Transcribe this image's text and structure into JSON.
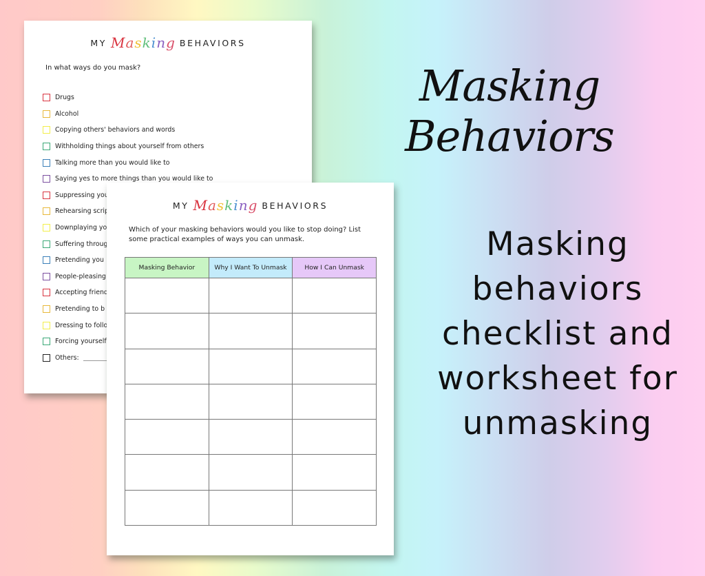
{
  "headline": "Masking Behaviors",
  "subtitle_lines": [
    "Masking",
    "behaviors",
    "checklist and",
    "worksheet for",
    "unmasking"
  ],
  "colors": {
    "red": "#d9333f",
    "orange": "#e8b83a",
    "yellow": "#f2ee4a",
    "green": "#3aa876",
    "blue": "#3a7fb8",
    "purple": "#7b4fa0",
    "black": "#222222",
    "header_green": "#c8f5c4",
    "header_blue": "#c3ebfb",
    "header_purple": "#e6c8f8"
  },
  "doc_title": {
    "prefix": "MY",
    "script_word": [
      "M",
      "a",
      "s",
      "k",
      "i",
      "n",
      "g"
    ],
    "script_colors": [
      "#d9333f",
      "#e05a5a",
      "#f0c23a",
      "#5fbf7a",
      "#4a8fd0",
      "#8a5fc0",
      "#d94f6a"
    ],
    "suffix": "BEHAVIORS"
  },
  "checklist_page": {
    "prompt": "In what ways do you mask?",
    "items": [
      {
        "label": "Drugs",
        "color": "#d9333f"
      },
      {
        "label": "Alcohol",
        "color": "#e8b83a"
      },
      {
        "label": "Copying others' behaviors and words",
        "color": "#f2ee4a"
      },
      {
        "label": "Withholding things about yourself from others",
        "color": "#3aa876"
      },
      {
        "label": "Talking more than you would like to",
        "color": "#3a7fb8"
      },
      {
        "label": "Saying yes to more things than you would like to",
        "color": "#7b4fa0"
      },
      {
        "label": "Suppressing you",
        "color": "#d9333f"
      },
      {
        "label": "Rehearsing scrip",
        "color": "#e8b83a"
      },
      {
        "label": "Downplaying yo",
        "color": "#f2ee4a"
      },
      {
        "label": "Suffering throug",
        "color": "#3aa876"
      },
      {
        "label": "Pretending you",
        "color": "#3a7fb8"
      },
      {
        "label": "People-pleasing",
        "color": "#7b4fa0"
      },
      {
        "label": "Accepting friend",
        "color": "#d9333f"
      },
      {
        "label": "Pretending to b",
        "color": "#e8b83a"
      },
      {
        "label": "Dressing to follo",
        "color": "#f2ee4a"
      },
      {
        "label": "Forcing yourself",
        "color": "#3aa876"
      },
      {
        "label": "Others:",
        "color": "#222222"
      }
    ]
  },
  "worksheet_page": {
    "prompt": "Which of your masking behaviors would you like to stop doing? List some practical examples of ways you can unmask.",
    "columns": [
      {
        "label": "Masking Behavior",
        "color": "#c8f5c4"
      },
      {
        "label": "Why I Want To Unmask",
        "color": "#c3ebfb"
      },
      {
        "label": "How I Can Unmask",
        "color": "#e6c8f8"
      }
    ],
    "empty_rows": 7
  }
}
